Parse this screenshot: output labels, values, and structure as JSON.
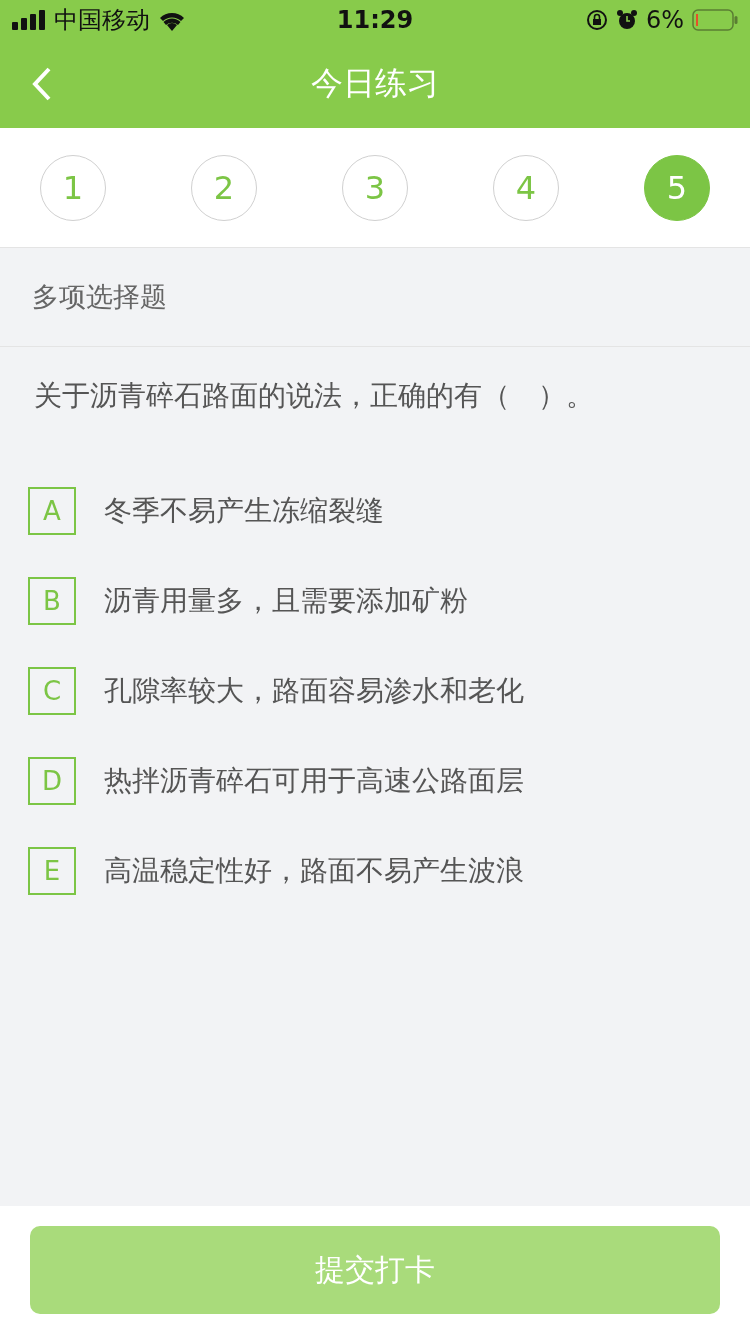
{
  "status_bar": {
    "carrier": "中国移动",
    "time": "11:29",
    "battery": "6%"
  },
  "nav": {
    "title": "今日练习"
  },
  "steps": [
    {
      "label": "1",
      "selected": false
    },
    {
      "label": "2",
      "selected": false
    },
    {
      "label": "3",
      "selected": false
    },
    {
      "label": "4",
      "selected": false
    },
    {
      "label": "5",
      "selected": true
    }
  ],
  "question_type": "多项选择题",
  "question": "关于沥青碎石路面的说法，正确的有（　）。",
  "options": [
    {
      "letter": "A",
      "text": "冬季不易产生冻缩裂缝",
      "checked": false
    },
    {
      "letter": "B",
      "text": "沥青用量多，且需要添加矿粉",
      "checked": false
    },
    {
      "letter": "C",
      "text": "孔隙率较大，路面容易渗水和老化",
      "checked": false
    },
    {
      "letter": "D",
      "text": "热拌沥青碎石可用于高速公路面层",
      "checked": false
    },
    {
      "letter": "E",
      "text": "高温稳定性好，路面不易产生波浪",
      "checked": false
    }
  ],
  "submit": {
    "label": "提交打卡",
    "disabled": true
  }
}
